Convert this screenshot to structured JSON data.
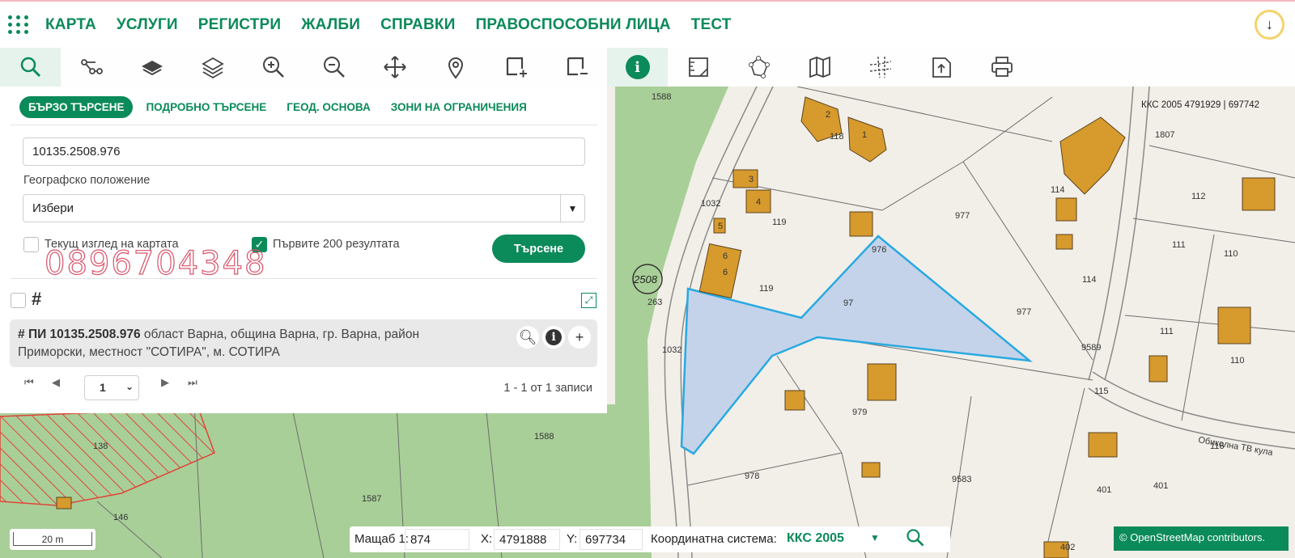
{
  "nav": {
    "items": [
      "КАРТА",
      "УСЛУГИ",
      "РЕГИСТРИ",
      "ЖАЛБИ",
      "СПРАВКИ",
      "ПРАВОСПОСОБНИ ЛИЦА",
      "ТЕСТ"
    ],
    "download_icon": "arrow-down-icon"
  },
  "toolbar": {
    "tools": [
      "search-icon",
      "route-icon",
      "layer-icon",
      "layers-icon",
      "zoom-in-icon",
      "zoom-out-icon",
      "pan-icon",
      "marker-icon",
      "add-area-icon",
      "remove-area-icon",
      "info-icon",
      "measure-icon",
      "polygon-icon",
      "map-icon",
      "grid-lines-icon",
      "export-icon",
      "print-icon"
    ],
    "active": [
      "search-icon",
      "info-icon"
    ]
  },
  "search": {
    "tabs": [
      "БЪРЗО ТЪРСЕНЕ",
      "ПОДРОБНО ТЪРСЕНЕ",
      "ГЕОД. ОСНОВА",
      "ЗОНИ НА ОГРАНИЧЕНИЯ"
    ],
    "query_value": "10135.2508.976",
    "geo_label": "Географско положение",
    "geo_value": "Избери",
    "current_view_label": "Текущ изглед на картата",
    "current_view_checked": false,
    "first200_label": "Първите 200 резултата",
    "first200_checked": true,
    "button_label": "Търсене",
    "watermark": "0896704348"
  },
  "results": {
    "title": "ПИ 10135.2508.976",
    "description_line1": " област Варна, община Варна, гр. Варна, район",
    "description_line2": "Приморски, местност \"СОТИРА\", м. СОТИРА",
    "page": "1",
    "records": "1 - 1 от 1 записи"
  },
  "coords": {
    "scale_label": "Мащаб 1:",
    "scale_value": "874",
    "x_label": "X:",
    "x_value": "4791888",
    "y_label": "Y:",
    "y_value": "697734",
    "system_label": "Координатна система:",
    "system_value": "ККС 2005"
  },
  "map": {
    "top_coord_label": "ККС 2005 4791929 | 697742",
    "scale_text": "20 m",
    "attribution": "© OpenStreetMap contributors.",
    "labels": [
      "1588",
      "118",
      "1",
      "2",
      "3",
      "4",
      "1032",
      "119",
      "5",
      "6",
      "2508",
      "263",
      "976",
      "97",
      "977",
      "114",
      "112",
      "111",
      "110",
      "1807",
      "9589",
      "115",
      "116",
      "978",
      "979",
      "9583",
      "401",
      "402",
      "138",
      "146",
      "1587",
      "1588",
      "Обиколна ТВ кула",
      "1032"
    ],
    "colors": {
      "parcel_fill": "#c5d3ea",
      "parcel_stroke": "#29a9e0",
      "building": "#d69a2d",
      "green": "#a9cf98",
      "hatch": "#e0453a"
    }
  }
}
